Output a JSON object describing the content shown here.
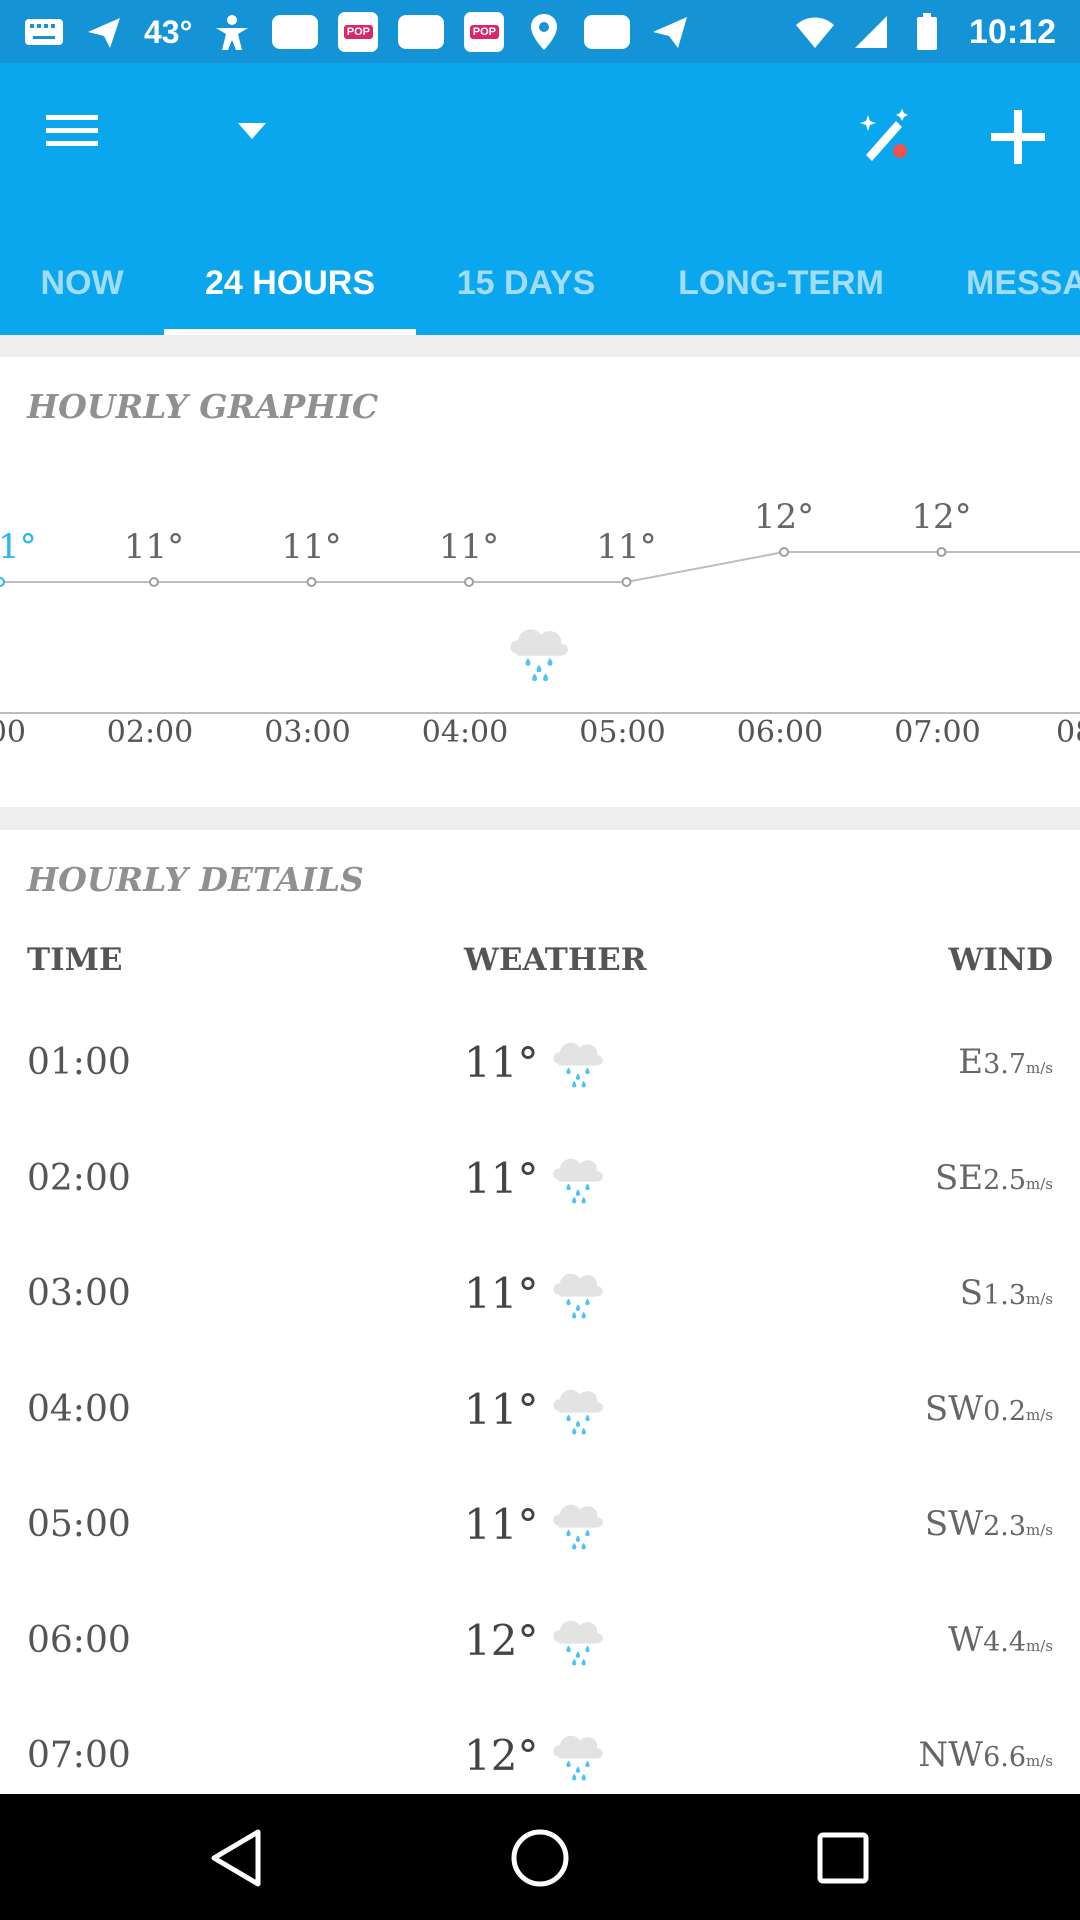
{
  "status_bar": {
    "temperature": "43°",
    "time": "10:12",
    "icons": [
      "keyboard-icon",
      "plane-icon",
      "person-icon",
      "box-icon",
      "popcorn-app-icon",
      "box-icon",
      "popcorn-app-icon",
      "location-icon",
      "box-icon",
      "send-icon",
      "wifi-icon",
      "signal-icon",
      "battery-icon"
    ],
    "pop_label": "POP"
  },
  "toolbar": {
    "menu_icon": "hamburger-menu-icon",
    "dropdown_icon": "dropdown-arrow-icon",
    "magic_icon": "magic-wand-icon",
    "add_icon": "plus-icon"
  },
  "tabs": [
    {
      "label": "NOW",
      "active": false
    },
    {
      "label": "24 HOURS",
      "active": true
    },
    {
      "label": "15 DAYS",
      "active": false
    },
    {
      "label": "LONG-TERM",
      "active": false
    },
    {
      "label": "MESSA",
      "active": false
    }
  ],
  "hourly_graphic": {
    "title": "HOURLY GRAPHIC",
    "partial_first_label": "1°",
    "partial_first_time": "00",
    "partial_last_time": "08"
  },
  "chart_data": {
    "type": "line",
    "x": [
      "02:00",
      "03:00",
      "04:00",
      "05:00",
      "06:00",
      "07:00"
    ],
    "series": [
      {
        "values": [
          11,
          11,
          11,
          11,
          12,
          12
        ]
      }
    ],
    "point_labels": [
      "11°",
      "11°",
      "11°",
      "11°",
      "12°",
      "12°"
    ],
    "icon_at": "04:00",
    "icon": "rain-cloud-icon",
    "grid": false
  },
  "hourly_details": {
    "title": "HOURLY DETAILS",
    "headers": {
      "time": "TIME",
      "weather": "WEATHER",
      "wind": "WIND"
    },
    "rows": [
      {
        "time": "01:00",
        "temp": "11°",
        "icon": "rain-cloud-icon",
        "wind_dir": "E",
        "wind_speed": "3.7",
        "wind_unit": "m/s"
      },
      {
        "time": "02:00",
        "temp": "11°",
        "icon": "rain-cloud-icon",
        "wind_dir": "SE",
        "wind_speed": "2.5",
        "wind_unit": "m/s"
      },
      {
        "time": "03:00",
        "temp": "11°",
        "icon": "rain-cloud-icon",
        "wind_dir": "S",
        "wind_speed": "1.3",
        "wind_unit": "m/s"
      },
      {
        "time": "04:00",
        "temp": "11°",
        "icon": "rain-cloud-icon",
        "wind_dir": "SW",
        "wind_speed": "0.2",
        "wind_unit": "m/s"
      },
      {
        "time": "05:00",
        "temp": "11°",
        "icon": "rain-cloud-icon",
        "wind_dir": "SW",
        "wind_speed": "2.3",
        "wind_unit": "m/s"
      },
      {
        "time": "06:00",
        "temp": "12°",
        "icon": "rain-cloud-icon",
        "wind_dir": "W",
        "wind_speed": "4.4",
        "wind_unit": "m/s"
      },
      {
        "time": "07:00",
        "temp": "12°",
        "icon": "rain-cloud-icon",
        "wind_dir": "NW",
        "wind_speed": "6.6",
        "wind_unit": "m/s"
      }
    ]
  },
  "nav_bar": {
    "back_icon": "back-triangle-icon",
    "home_icon": "home-circle-icon",
    "recents_icon": "recents-square-icon"
  },
  "colors": {
    "app_bar": "#0aa7ef",
    "status_bar": "#1493d6",
    "accent": "#29b6f6",
    "magic_dot": "#ef5350"
  }
}
